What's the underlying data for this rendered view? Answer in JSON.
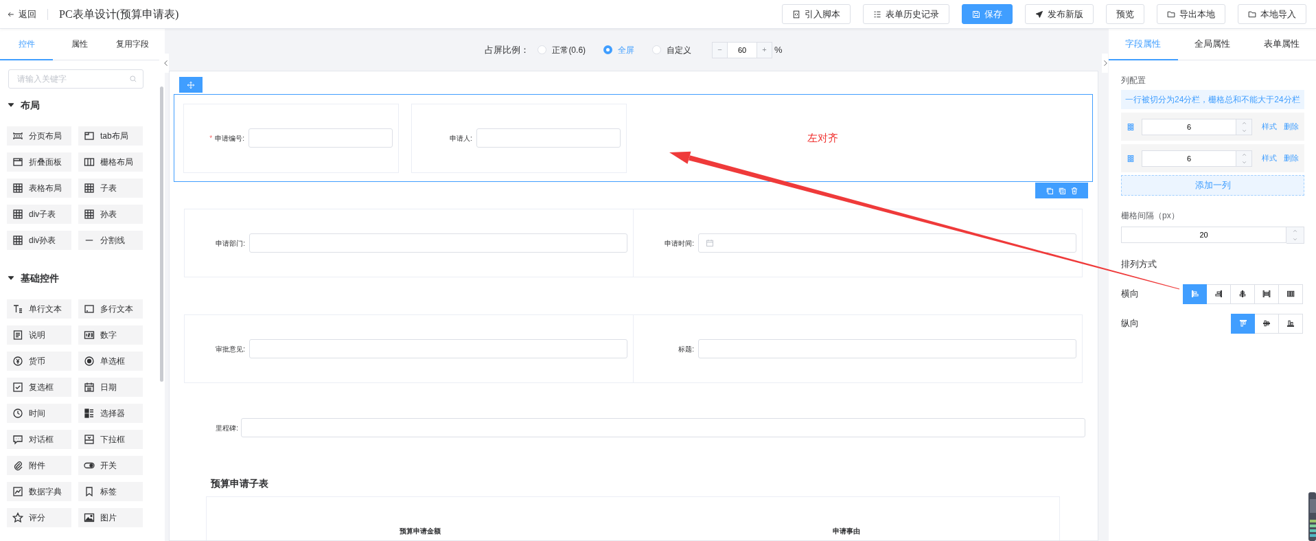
{
  "header": {
    "back_label": "返回",
    "title": "PC表单设计(预算申请表)",
    "buttons": [
      {
        "label": "引入脚本",
        "kind": "script",
        "primary": false
      },
      {
        "label": "表单历史记录",
        "kind": "history",
        "primary": false
      },
      {
        "label": "保存",
        "kind": "save",
        "primary": true
      },
      {
        "label": "发布新版",
        "kind": "publish",
        "primary": false
      },
      {
        "label": "预览",
        "kind": "none",
        "primary": false
      },
      {
        "label": "导出本地",
        "kind": "folder",
        "primary": false
      },
      {
        "label": "本地导入",
        "kind": "folder",
        "primary": false
      }
    ]
  },
  "sidebar": {
    "tabs": [
      {
        "label": "控件",
        "selected": true
      },
      {
        "label": "属性",
        "selected": false
      },
      {
        "label": "复用字段",
        "selected": false
      }
    ],
    "search": {
      "placeholder": "请输入关键字"
    },
    "groups": [
      {
        "title": "布局",
        "expanded": true,
        "items": [
          {
            "label": "分页布局",
            "kind": "pages"
          },
          {
            "label": "tab布局",
            "kind": "tab"
          },
          {
            "label": "折叠面板",
            "kind": "collapse"
          },
          {
            "label": "栅格布局",
            "kind": "grid"
          },
          {
            "label": "表格布局",
            "kind": "table"
          },
          {
            "label": "子表",
            "kind": "table"
          },
          {
            "label": "div子表",
            "kind": "table"
          },
          {
            "label": "孙表",
            "kind": "table"
          },
          {
            "label": "div孙表",
            "kind": "table"
          },
          {
            "label": "分割线",
            "kind": "divider"
          }
        ]
      },
      {
        "title": "基础控件",
        "expanded": true,
        "items": [
          {
            "label": "单行文本",
            "kind": "text"
          },
          {
            "label": "多行文本",
            "kind": "textarea"
          },
          {
            "label": "说明",
            "kind": "note"
          },
          {
            "label": "数字",
            "kind": "number"
          },
          {
            "label": "货币",
            "kind": "currency"
          },
          {
            "label": "单选框",
            "kind": "radio"
          },
          {
            "label": "复选框",
            "kind": "checkbox"
          },
          {
            "label": "日期",
            "kind": "date"
          },
          {
            "label": "时间",
            "kind": "time"
          },
          {
            "label": "选择器",
            "kind": "selector"
          },
          {
            "label": "对话框",
            "kind": "dialog"
          },
          {
            "label": "下拉框",
            "kind": "dropdown"
          },
          {
            "label": "附件",
            "kind": "attach"
          },
          {
            "label": "开关",
            "kind": "switch"
          },
          {
            "label": "数据字典",
            "kind": "dict"
          },
          {
            "label": "标签",
            "kind": "tag"
          },
          {
            "label": "评分",
            "kind": "rating"
          },
          {
            "label": "图片",
            "kind": "image"
          }
        ]
      }
    ]
  },
  "canvas": {
    "ratio": {
      "label": "占屏比例：",
      "options": [
        {
          "label": "正常(0.6)",
          "selected": false
        },
        {
          "label": "全屏",
          "selected": true
        },
        {
          "label": "自定义",
          "selected": false
        }
      ],
      "decrement": "−",
      "value": "60",
      "increment": "+",
      "unit": "%"
    },
    "rows": [
      {
        "kind": "grid",
        "selected": true,
        "annotation": "左对齐",
        "cells": [
          {
            "label": "申请编号:",
            "required_mark": "*",
            "kind": "text"
          },
          {
            "label": "申请人:",
            "kind": "text"
          }
        ]
      },
      {
        "kind": "grid",
        "selected": false,
        "cells": [
          {
            "label": "申请部门:",
            "kind": "text"
          },
          {
            "label": "申请时间:",
            "kind": "date"
          }
        ]
      },
      {
        "kind": "grid",
        "selected": false,
        "cells": [
          {
            "label": "审批意见:",
            "kind": "text"
          },
          {
            "label": "标题:",
            "kind": "text"
          }
        ]
      },
      {
        "kind": "field",
        "selected": false,
        "cells": [
          {
            "label": "里程碑:",
            "kind": "text"
          }
        ]
      }
    ],
    "subtable": {
      "title": "预算申请子表",
      "columns": [
        "预算申请金额",
        "申请事由"
      ]
    }
  },
  "properties": {
    "tabs": [
      {
        "label": "字段属性",
        "selected": true
      },
      {
        "label": "全局属性",
        "selected": false
      },
      {
        "label": "表单属性",
        "selected": false
      }
    ],
    "columns_label": "列配置",
    "hint": "一行被切分为24分栏，栅格总和不能大于24分栏",
    "columns": [
      {
        "value": "6",
        "style_link": "样式",
        "delete_link": "删除"
      },
      {
        "value": "6",
        "style_link": "样式",
        "delete_link": "删除"
      }
    ],
    "add_column": "添加一列",
    "gutter": {
      "label": "栅格间隔（px）",
      "value": "20"
    },
    "arrange_label": "排列方式",
    "horizontal": {
      "label": "横向",
      "options": [
        {
          "kind": "left",
          "selected": true
        },
        {
          "kind": "right",
          "selected": false
        },
        {
          "kind": "center",
          "selected": false
        },
        {
          "kind": "between",
          "selected": false
        },
        {
          "kind": "around",
          "selected": false
        }
      ]
    },
    "vertical": {
      "label": "纵向",
      "options": [
        {
          "kind": "top",
          "selected": true
        },
        {
          "kind": "middle",
          "selected": false
        },
        {
          "kind": "bottom",
          "selected": false
        }
      ]
    }
  }
}
